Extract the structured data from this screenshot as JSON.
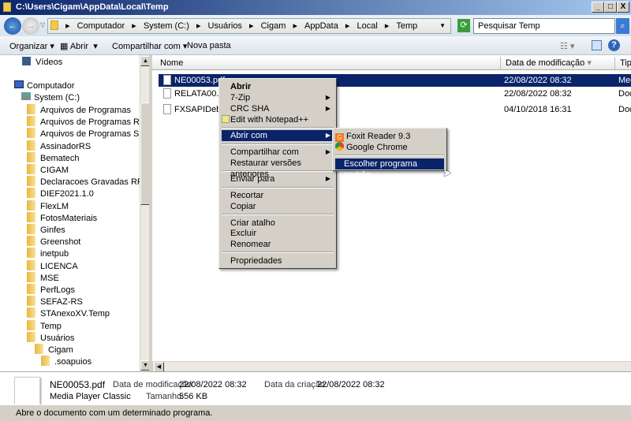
{
  "window": {
    "title": "C:\\Users\\Cigam\\AppData\\Local\\Temp",
    "minimize": "_",
    "maximize": "□",
    "close": "X"
  },
  "address": {
    "breadcrumb": [
      "Computador",
      "System (C:)",
      "Usuários",
      "Cigam",
      "AppData",
      "Local",
      "Temp"
    ],
    "search_placeholder": "Pesquisar Temp"
  },
  "toolbar": {
    "organize": "Organizar",
    "open": "Abrir",
    "share": "Compartilhar com",
    "new_folder": "Nova pasta"
  },
  "tree": {
    "videos": "Vídeos",
    "computer": "Computador",
    "drive": "System (C:)",
    "folders": [
      "Arquivos de Programas",
      "Arquivos de Programas RFB",
      "Arquivos de Programas SEF-MG",
      "AssinadorRS",
      "Bematech",
      "CIGAM",
      "Declaracoes Gravadas RFB",
      "DIEF2021.1.0",
      "FlexLM",
      "FotosMateriais",
      "Ginfes",
      "Greenshot",
      "inetpub",
      "LICENCA",
      "MSE",
      "PerfLogs",
      "SEFAZ-RS",
      "STAnexoXV.Temp",
      "Temp",
      "Usuários"
    ],
    "user": "Cigam",
    "subfolder": ".soapuios"
  },
  "list": {
    "columns": [
      "Nome",
      "Data de modificação",
      "Tipo"
    ],
    "rows": [
      {
        "name": "NE00053.pdf",
        "date": "22/08/2022 08:32",
        "type": "Media Player Classic",
        "selected": true
      },
      {
        "name": "RELATA00.TXT",
        "date": "22/08/2022 08:32",
        "type": "Documento"
      },
      {
        "name": "FXSAPIDebugLog",
        "date": "04/10/2018 16:31",
        "type": "Documento"
      }
    ]
  },
  "context_menu": {
    "items": [
      "Abrir",
      "7-Zip",
      "CRC SHA",
      "Edit with Notepad++",
      "Abrir com",
      "Compartilhar com",
      "Restaurar versões anteriores",
      "Enviar para",
      "Recortar",
      "Copiar",
      "Criar atalho",
      "Excluir",
      "Renomear",
      "Propriedades"
    ]
  },
  "submenu": {
    "items": [
      "Foxit Reader 9.3",
      "Google Chrome",
      "Escolher programa padrão..."
    ]
  },
  "details": {
    "filename": "NE00053.pdf",
    "app": "Media Player Classic",
    "modified_label": "Data de modificação:",
    "modified": "22/08/2022 08:32",
    "created_label": "Data da criação:",
    "created": "22/08/2022 08:32",
    "size_label": "Tamanho:",
    "size": "556 KB"
  },
  "status": {
    "text": "Abre o documento com um determinado programa."
  },
  "colors": {
    "selection": "#0a246a",
    "title_start": "#0a246a",
    "title_end": "#a6caf0"
  }
}
